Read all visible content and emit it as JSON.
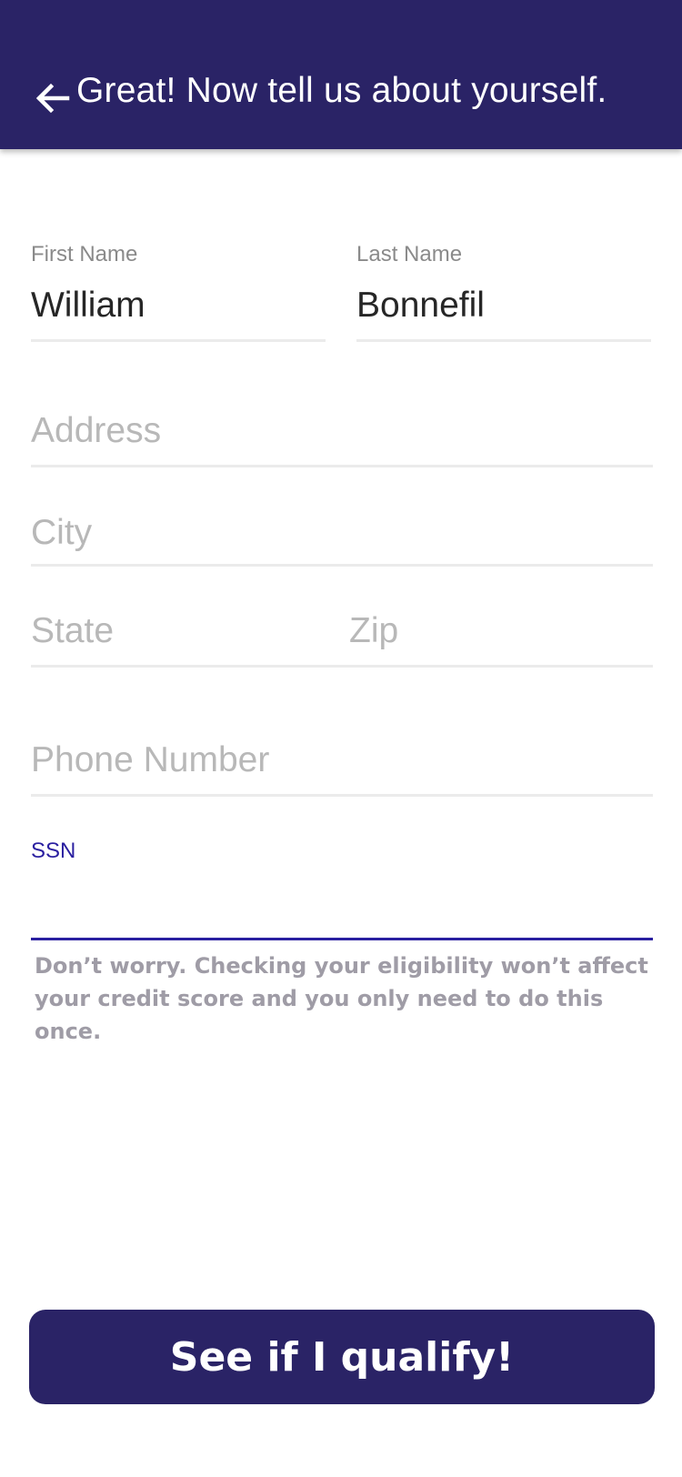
{
  "header": {
    "back_icon": "arrow-left-icon",
    "title": "Great! Now tell us about yourself."
  },
  "form": {
    "first_name": {
      "label": "First Name",
      "value": "William"
    },
    "last_name": {
      "label": "Last Name",
      "value": "Bonnefil"
    },
    "address": {
      "placeholder": "Address"
    },
    "city": {
      "placeholder": "City"
    },
    "state": {
      "placeholder": "State"
    },
    "zip": {
      "placeholder": "Zip"
    },
    "phone": {
      "placeholder": "Phone Number"
    },
    "ssn": {
      "label": "SSN",
      "value": ""
    }
  },
  "helper_text": "Don’t worry. Checking your eligibility won’t affect your credit score and you only need to do this once.",
  "submit_label": "See if I qualify!",
  "colors": {
    "primary": "#2a2366",
    "focus_accent": "#2a1fa0",
    "placeholder": "#b8b8b8",
    "helper_text": "#9f9ca6"
  }
}
